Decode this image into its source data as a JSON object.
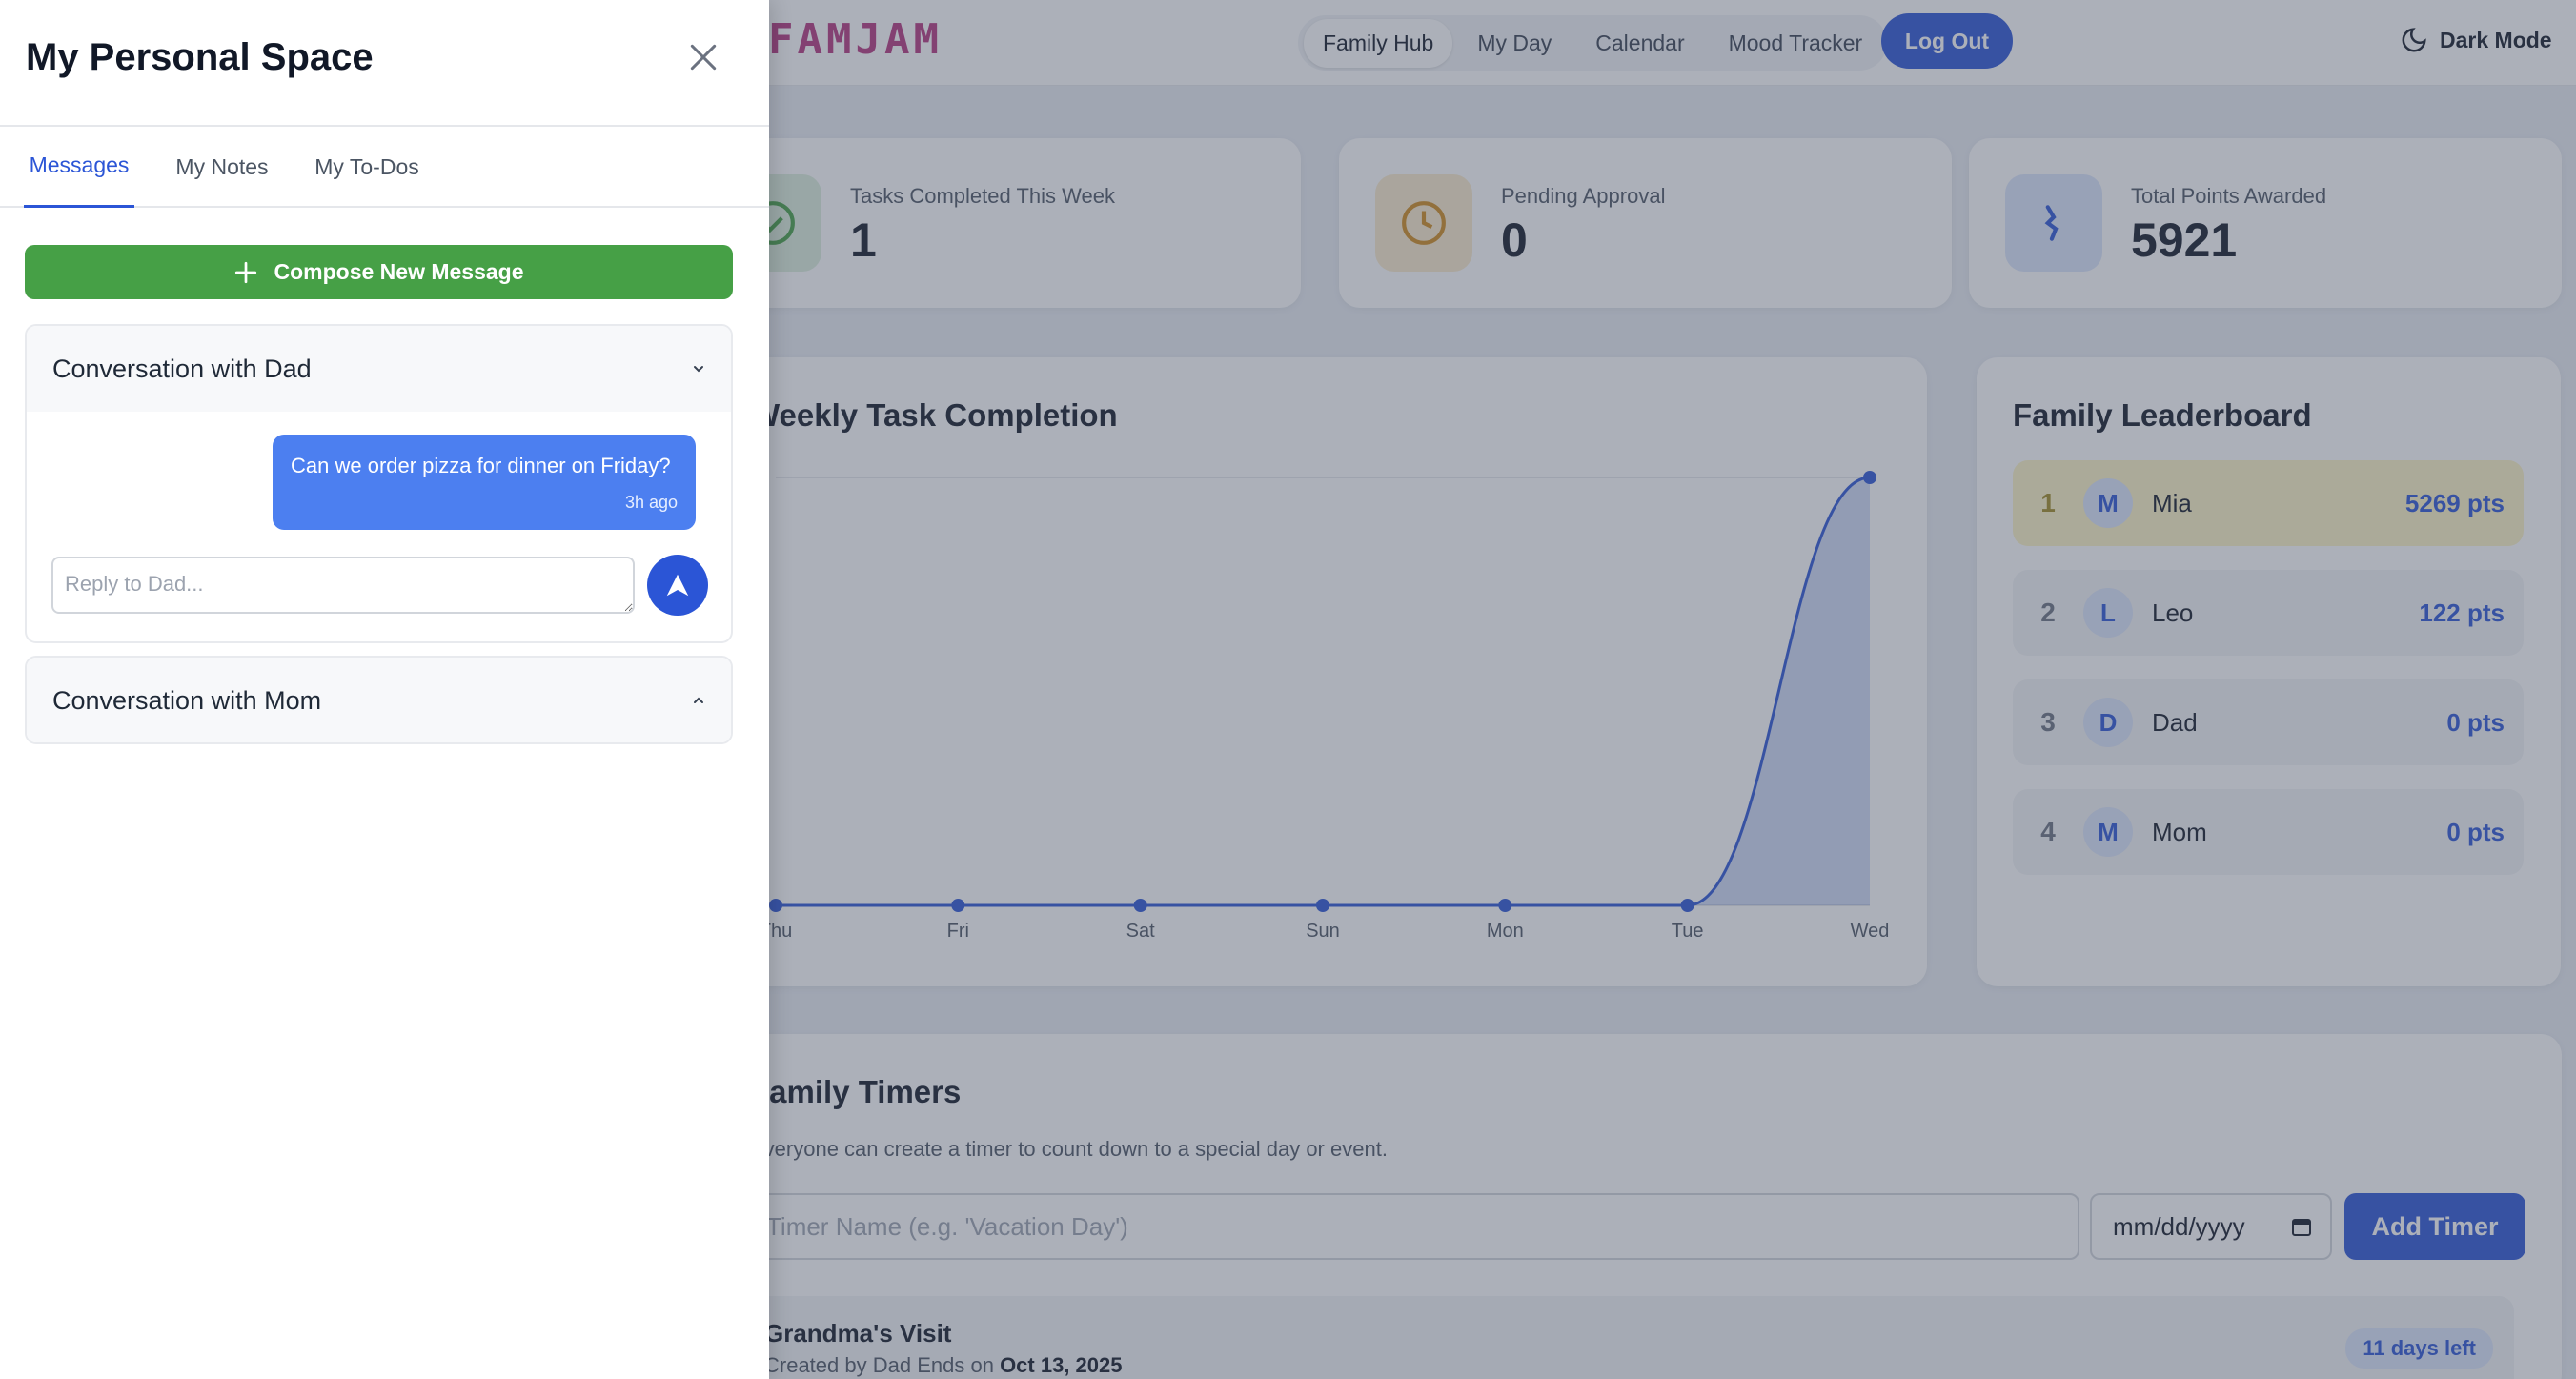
{
  "topbar": {
    "logo": "FAMJAM",
    "nav": [
      "Family Hub",
      "My Day",
      "Calendar",
      "Mood Tracker"
    ],
    "active_nav": "Family Hub",
    "logout_label": "Log Out",
    "dark_mode_label": "Dark Mode"
  },
  "stats": [
    {
      "label": "Tasks Completed This Week",
      "value": "1",
      "icon": "check-circle-icon",
      "color": "#46a046"
    },
    {
      "label": "Pending Approval",
      "value": "0",
      "icon": "clock-icon",
      "color": "#d08a1c"
    },
    {
      "label": "Total Points Awarded",
      "value": "5921",
      "icon": "points-icon",
      "color": "#2b55d6"
    }
  ],
  "weekly_chart": {
    "title": "Weekly Task Completion"
  },
  "chart_data": {
    "type": "area",
    "categories": [
      "Thu",
      "Fri",
      "Sat",
      "Sun",
      "Mon",
      "Tue",
      "Wed"
    ],
    "values": [
      0,
      0,
      0,
      0,
      0,
      0,
      1
    ],
    "title": "Weekly Task Completion",
    "grid": true
  },
  "leaderboard": {
    "title": "Family Leaderboard",
    "rows": [
      {
        "rank": "1",
        "initial": "M",
        "name": "Mia",
        "points": "5269 pts"
      },
      {
        "rank": "2",
        "initial": "L",
        "name": "Leo",
        "points": "122 pts"
      },
      {
        "rank": "3",
        "initial": "D",
        "name": "Dad",
        "points": "0 pts"
      },
      {
        "rank": "4",
        "initial": "M",
        "name": "Mom",
        "points": "0 pts"
      }
    ]
  },
  "timers": {
    "title": "Family Timers",
    "subtitle": "Everyone can create a timer to count down to a special day or event.",
    "name_placeholder": "Timer Name (e.g. 'Vacation Day')",
    "date_placeholder": "mm/dd/yyyy",
    "add_label": "Add Timer",
    "items": [
      {
        "name": "Grandma's Visit",
        "created_by": "Created by Dad Ends on",
        "end_date": "Oct 13, 2025",
        "remaining": "11 days left"
      }
    ]
  },
  "drawer": {
    "title": "My Personal Space",
    "tabs": [
      "Messages",
      "My Notes",
      "My To-Dos"
    ],
    "active_tab": "Messages",
    "compose_label": "Compose New Message",
    "conversations": [
      {
        "title": "Conversation with Dad",
        "expanded": true,
        "messages": [
          {
            "text": "Can we order pizza for dinner on Friday?",
            "time": "3h ago"
          }
        ],
        "reply_placeholder": "Reply to Dad..."
      },
      {
        "title": "Conversation with Mom",
        "expanded": false
      }
    ]
  },
  "colors": {
    "accent": "#2b55d6",
    "compose_green": "#46a046",
    "bubble": "#4c7ff0",
    "logo": "#b4367f"
  }
}
